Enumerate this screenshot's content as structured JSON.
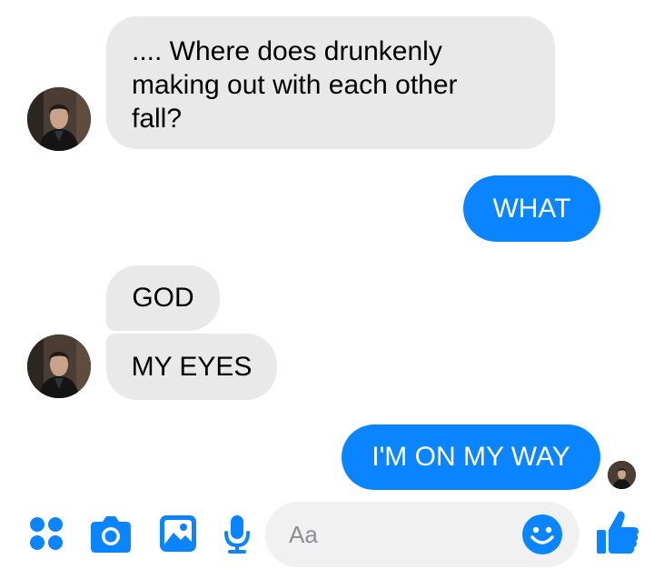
{
  "messages": [
    {
      "id": "m1",
      "direction": "incoming",
      "text": ".... Where does drunkenly\nmaking out with each other\nfall?"
    },
    {
      "id": "m2",
      "direction": "outgoing",
      "text": "WHAT"
    },
    {
      "id": "m3",
      "direction": "incoming",
      "text": "GOD"
    },
    {
      "id": "m4",
      "direction": "incoming",
      "text": "MY EYES"
    },
    {
      "id": "m5",
      "direction": "outgoing",
      "text": "I'M ON MY WAY"
    }
  ],
  "composer": {
    "placeholder": "Aa",
    "icons": [
      "apps-icon",
      "camera-icon",
      "gallery-icon",
      "microphone-icon",
      "emoji-icon",
      "thumbs-up-icon"
    ]
  },
  "colors": {
    "accent": "#0a84ff",
    "incoming_bubble": "#e9e9e9",
    "input_bg": "#f1f1f2"
  }
}
